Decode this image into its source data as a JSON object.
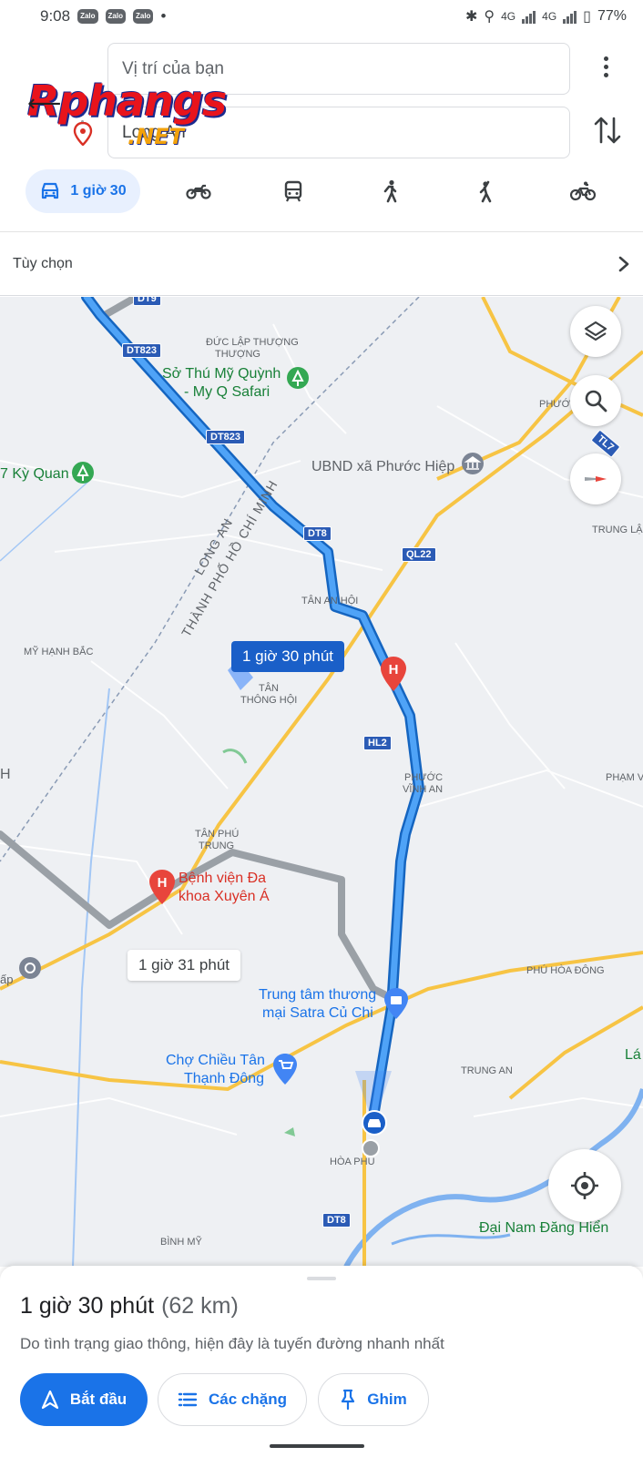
{
  "status_bar": {
    "time": "9:08",
    "notification_icons": [
      "Zalo",
      "Zalo",
      "Zalo"
    ],
    "network": "4G",
    "network2": "4G",
    "battery": "77%"
  },
  "watermark": {
    "line1": "Rphangs",
    "line2": ".NET"
  },
  "route": {
    "origin_value": "Vị trí của bạn",
    "destination_value": "Long An"
  },
  "modes": {
    "active_label": "1 giờ 30",
    "items": [
      "car-icon",
      "motorbike-icon",
      "transit-icon",
      "walk-icon",
      "ride-hail-icon",
      "bicycle-icon"
    ]
  },
  "options": {
    "label": "Tùy chọn"
  },
  "map": {
    "route_primary_label": "1 giờ 30 phút",
    "route_alt_label": "1 giờ 31 phút",
    "road_shields": [
      "DT9",
      "DT823",
      "DT823",
      "DT8",
      "QL22",
      "HL2",
      "DT8",
      "TL7"
    ],
    "places": {
      "duc_lap_thuong": "ĐỨC LẬP THƯỢNG",
      "so_thu_line1": "Sở Thú Mỹ Quỳnh",
      "so_thu_line2": "- My Q Safari",
      "ky_quan": "7 Kỳ Quan",
      "ubnd": "UBND xã Phước Hiệp",
      "phuoc": "PHƯỚC",
      "trung_lap": "TRUNG LẬP",
      "long_an": "LONG AN",
      "tp_hcm": "THÀNH PHỐ HỒ CHÍ MINH",
      "tan_an_hoi": "TÂN AN HỘI",
      "my_hanh_bac": "MỸ HẠNH BẮC",
      "tan_thong_hoi_1": "TÂN",
      "tan_thong_hoi_2": "THÔNG HỘI",
      "phuoc_vinh_an_1": "PHƯỚC",
      "phuoc_vinh_an_2": "VĨNH AN",
      "pham_van": "PHẠM VĂ",
      "tan_phu_trung_1": "TÂN PHÚ",
      "tan_phu_trung_2": "TRUNG",
      "benh_vien_1": "Bệnh viện Đa",
      "benh_vien_2": "khoa Xuyên Á",
      "ap": "ấp",
      "phu_hoa_dong": "PHÚ HÒA ĐÔNG",
      "satra_1": "Trung tâm thương",
      "satra_2": "mại Satra Củ Chi",
      "cho_chieu_1": "Chợ Chiều Tân",
      "cho_chieu_2": "Thạnh Đông",
      "trung_an": "TRUNG AN",
      "hoa_phu": "HÒA PHÚ",
      "binh_my": "BÌNH MỸ",
      "dai_nam": "Đại Nam Đăng Hiển",
      "lai": "Lá",
      "h_left": "H"
    }
  },
  "sheet": {
    "duration": "1 giờ 30 phút",
    "distance": "(62 km)",
    "note": "Do tình trạng giao thông, hiện đây là tuyến đường nhanh nhất",
    "start_label": "Bắt đầu",
    "steps_label": "Các chặng",
    "pin_label": "Ghim"
  },
  "colors": {
    "route_primary": "#1a73e8",
    "route_alt": "#9aa0a6",
    "accent": "#1a73e8",
    "hospital": "#e8453c"
  }
}
